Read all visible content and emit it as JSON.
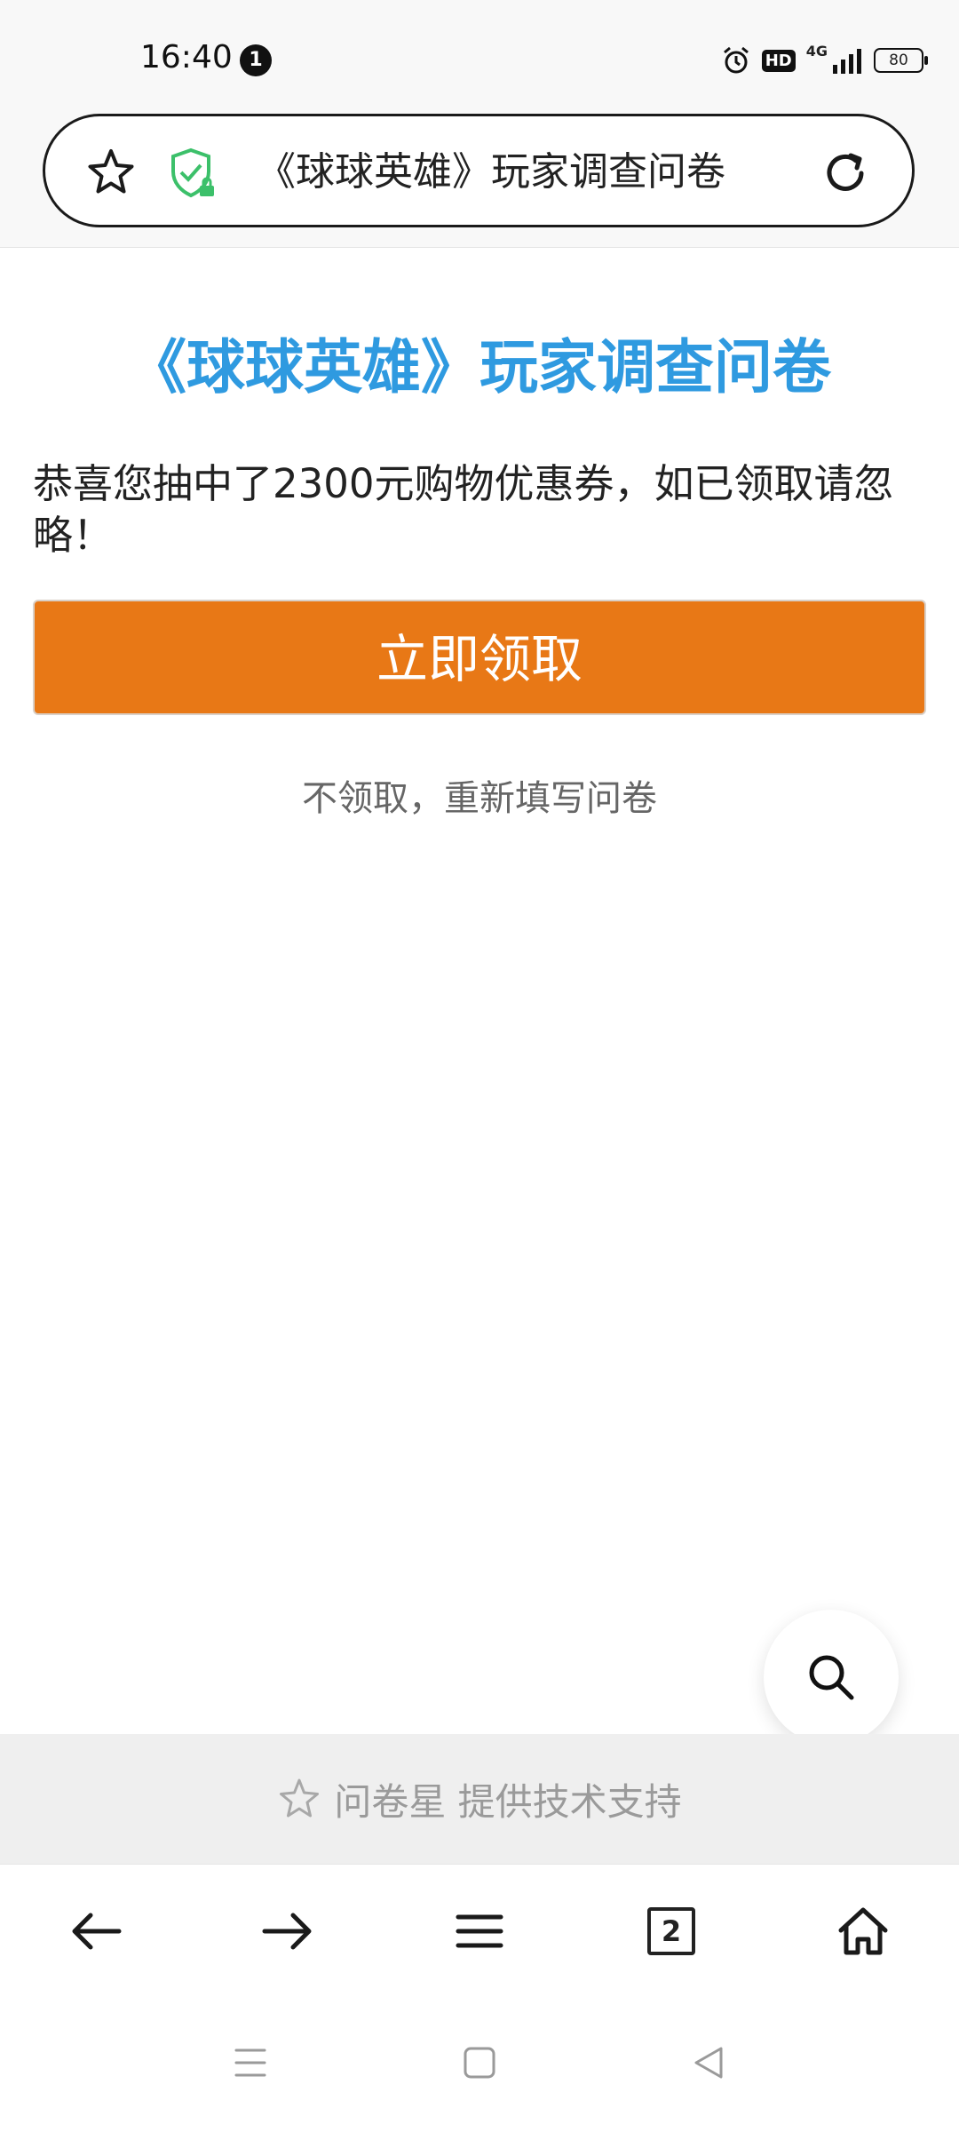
{
  "status_bar": {
    "time": "16:40",
    "notification_count": "1",
    "hd_label": "HD",
    "network_label": "4G",
    "battery_level": "80",
    "icons": [
      "alarm-icon",
      "hd-icon",
      "signal-icon",
      "battery-icon"
    ]
  },
  "address_bar": {
    "page_title": "《球球英雄》玩家调查问卷",
    "icons": [
      "star-icon",
      "secure-shield-icon",
      "reload-icon"
    ],
    "shield_color": "#3cc06a"
  },
  "page": {
    "heading": "《球球英雄》玩家调查问卷",
    "message": "恭喜您抽中了2300元购物优惠券，如已领取请忽略！",
    "claim_button_label": "立即领取",
    "refill_link": "不领取，重新填写问卷",
    "heading_color": "#2f9ae0",
    "button_color": "#e87816"
  },
  "fab": {
    "icon": "search-icon"
  },
  "footer": {
    "text": "问卷星 提供技术支持",
    "icon": "star-outline-icon"
  },
  "toolbar": {
    "tab_count": "2",
    "icons": [
      "back-arrow-icon",
      "forward-arrow-icon",
      "menu-icon",
      "tabs-icon",
      "home-icon"
    ]
  },
  "system_nav": {
    "icons": [
      "recent-apps-icon",
      "home-square-icon",
      "back-triangle-icon"
    ]
  }
}
